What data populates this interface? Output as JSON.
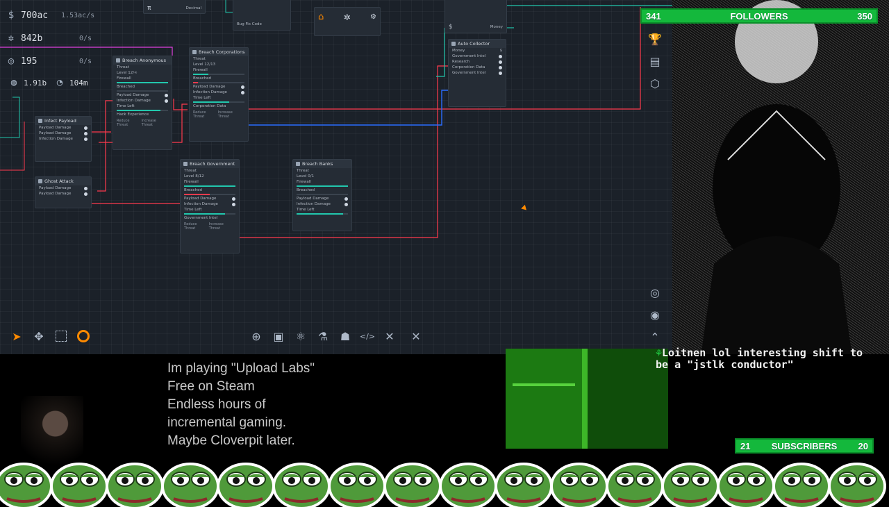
{
  "resources": {
    "currency": {
      "value": "700ac",
      "rate": "1.53ac/s"
    },
    "cpu": {
      "value": "842b",
      "rate": "0/s"
    },
    "disk": {
      "value": "195",
      "rate": "0/s"
    },
    "ram": {
      "value": "1.91b"
    },
    "bandwidth": {
      "value": "104m"
    }
  },
  "nodes": {
    "breach_anonymous": {
      "title": "Breach Anonymous",
      "threat": "Threat",
      "level": "Level 12/∞",
      "firewall": "Firewall",
      "breached": "Breached",
      "payload": "Payload Damage",
      "infection": "Infection Damage",
      "time_left": "Time Left",
      "hack_exp": "Hack Experience",
      "reduce": "Reduce Threat",
      "increase": "Increase Threat"
    },
    "breach_corporations": {
      "title": "Breach Corporations",
      "threat": "Threat",
      "level": "Level 12/13",
      "firewall": "Firewall",
      "breached": "Breached",
      "payload": "Payload Damage",
      "infection": "Infection Damage",
      "time_left": "Time Left",
      "corp_data": "Corporation Data",
      "reduce": "Reduce Threat",
      "increase": "Increase Threat"
    },
    "breach_government": {
      "title": "Breach Government",
      "threat": "Threat",
      "level": "Level 8/12",
      "firewall": "Firewall",
      "breached": "Breached",
      "payload": "Payload Damage",
      "infection": "Infection Damage",
      "time_left": "Time Left",
      "gov_intel": "Government Intel",
      "reduce": "Reduce Threat",
      "increase": "Increase Threat"
    },
    "breach_banks": {
      "title": "Breach Banks",
      "threat": "Threat",
      "level": "Level 0/1",
      "firewall": "Firewall",
      "breached": "Breached",
      "payload": "Payload Damage",
      "infection": "Infection Damage",
      "time_left": "Time Left"
    },
    "infect_payload": {
      "title": "Infect Payload",
      "payload": "Payload Damage",
      "payload2": "Payload Damage",
      "infection": "Infection Damage"
    },
    "ghost_attack": {
      "title": "Ghost Attack",
      "payload": "Payload Damage",
      "payload2": "Payload Damage"
    },
    "auto_collector": {
      "title": "Auto Collector",
      "money": "Money",
      "gov_intel": "Government Intel",
      "research": "Research",
      "corp_data": "Corporation Data",
      "gov_intel2": "Government Intel"
    },
    "bug_fix": {
      "label": "Bug Fix Code"
    },
    "decimal": {
      "label": "Decimal"
    },
    "money_top": {
      "label": "Money"
    }
  },
  "stream": {
    "followers": {
      "left": "341",
      "label": "FOLLOWERS",
      "right": "350"
    },
    "subscribers": {
      "left": "21",
      "label": "SUBSCRIBERS",
      "right": "20"
    },
    "caption": [
      "Im playing \"Upload Labs\"",
      "Free on Steam",
      "Endless hours of",
      "incremental gaming.",
      "Maybe Cloverpit later."
    ],
    "chat": {
      "user": "Loitnen",
      "message": "lol interesting shift to be a \"jstlk conductor\""
    }
  },
  "colors": {
    "accent": "#ff8a00",
    "wire_red": "#ff3b4e",
    "wire_blue": "#2a6dff",
    "wire_teal": "#22c7ad",
    "wire_magenta": "#e040e0",
    "counter_green": "#14b83c"
  }
}
